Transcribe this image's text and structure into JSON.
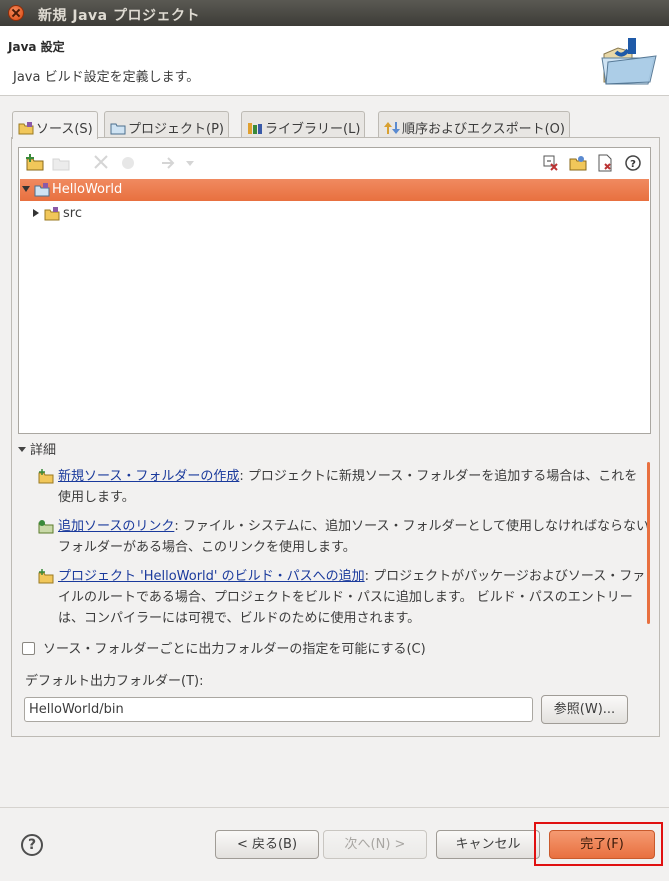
{
  "window": {
    "title": "新規 Java プロジェクト"
  },
  "header": {
    "title": "Java 設定",
    "description": "Java ビルド設定を定義します。"
  },
  "tabs": [
    {
      "label": "ソース(S)",
      "active": true,
      "icon": "source-folder-icon"
    },
    {
      "label": "プロジェクト(P)",
      "active": false,
      "icon": "project-icon"
    },
    {
      "label": "ライブラリー(L)",
      "active": false,
      "icon": "library-icon"
    },
    {
      "label": "順序およびエクスポート(O)",
      "active": false,
      "icon": "order-export-icon"
    }
  ],
  "tree": {
    "items": [
      {
        "label": "HelloWorld",
        "expanded": true,
        "selected": true
      },
      {
        "label": "src",
        "expanded": false,
        "selected": false
      }
    ]
  },
  "details": {
    "header": "詳細",
    "items": [
      {
        "link": "新規ソース・フォルダーの作成",
        "text": ": プロジェクトに新規ソース・フォルダーを追加する場合は、これを使用します。"
      },
      {
        "link": "追加ソースのリンク",
        "text": ": ファイル・システムに、追加ソース・フォルダーとして使用しなければならないフォルダーがある場合、このリンクを使用します。"
      },
      {
        "link": "プロジェクト 'HelloWorld' のビルド・パスへの追加",
        "text": ": プロジェクトがパッケージおよびソース・ファイルのルートである場合、プロジェクトをビルド・パスに追加します。 ビルド・パスのエントリーは、コンパイラーには可視で、ビルドのために使用されます。"
      }
    ]
  },
  "options": {
    "allow_output_folders_label": "ソース・フォルダーごとに出力フォルダーの指定を可能にする(C)",
    "allow_output_folders_checked": false,
    "default_output_label": "デフォルト出力フォルダー(T):",
    "default_output_value": "HelloWorld/bin",
    "browse_label": "参照(W)..."
  },
  "footer": {
    "back_label": "< 戻る(B)",
    "next_label": "次へ(N) >",
    "cancel_label": "キャンセル",
    "finish_label": "完了(F)"
  },
  "colors": {
    "selection": "#e8703f",
    "link": "#1a3a9c",
    "highlight_box": "#e01010"
  }
}
